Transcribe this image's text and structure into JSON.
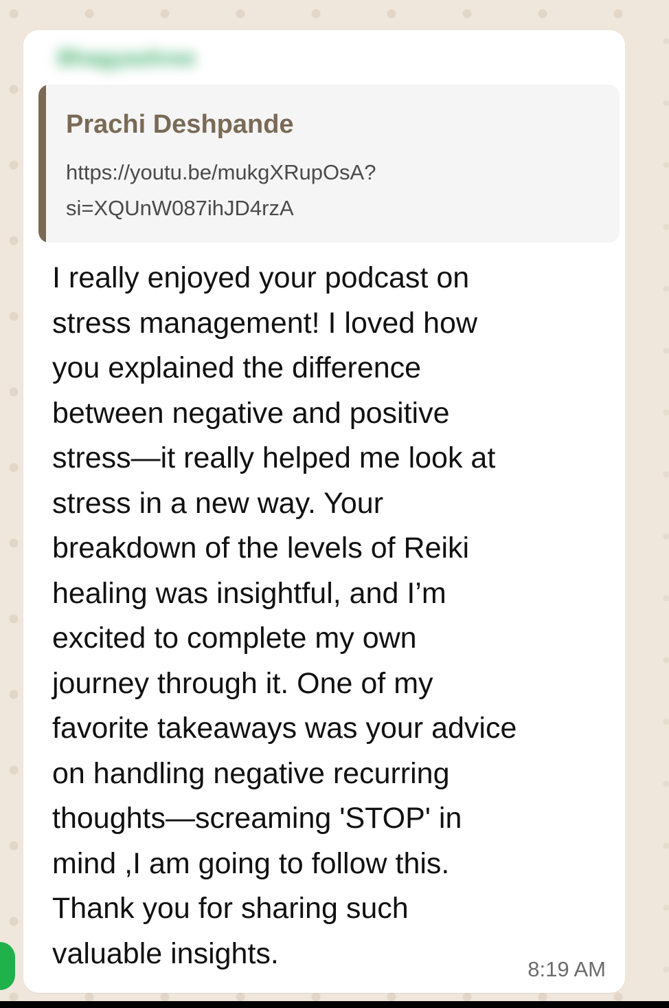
{
  "chat": {
    "sender_name": "Bhagyashree",
    "quoted": {
      "author": "Prachi Deshpande",
      "text": "https://youtu.be/mukgXRupOsA?\nsi=XQUnW087ihJD4rzA"
    },
    "message_text": "I really enjoyed your podcast on\nstress management! I loved how\nyou explained the difference\nbetween negative and positive\nstress—it really helped me look at\nstress in a new way. Your\nbreakdown of the levels of Reiki\nhealing was insightful, and I’m\nexcited to complete my own\njourney through it. One of my\nfavorite takeaways was your advice\non handling negative recurring\nthoughts—screaming 'STOP' in\nmind ,I am going to follow this.\nThank you for sharing such\nvaluable insights.",
    "timestamp": "8:19 AM"
  },
  "colors": {
    "quote_bar": "#7a6a55",
    "bubble": "#ffffff",
    "wallpaper": "#efe7dc",
    "sender_blurred": "#3fae6a"
  }
}
